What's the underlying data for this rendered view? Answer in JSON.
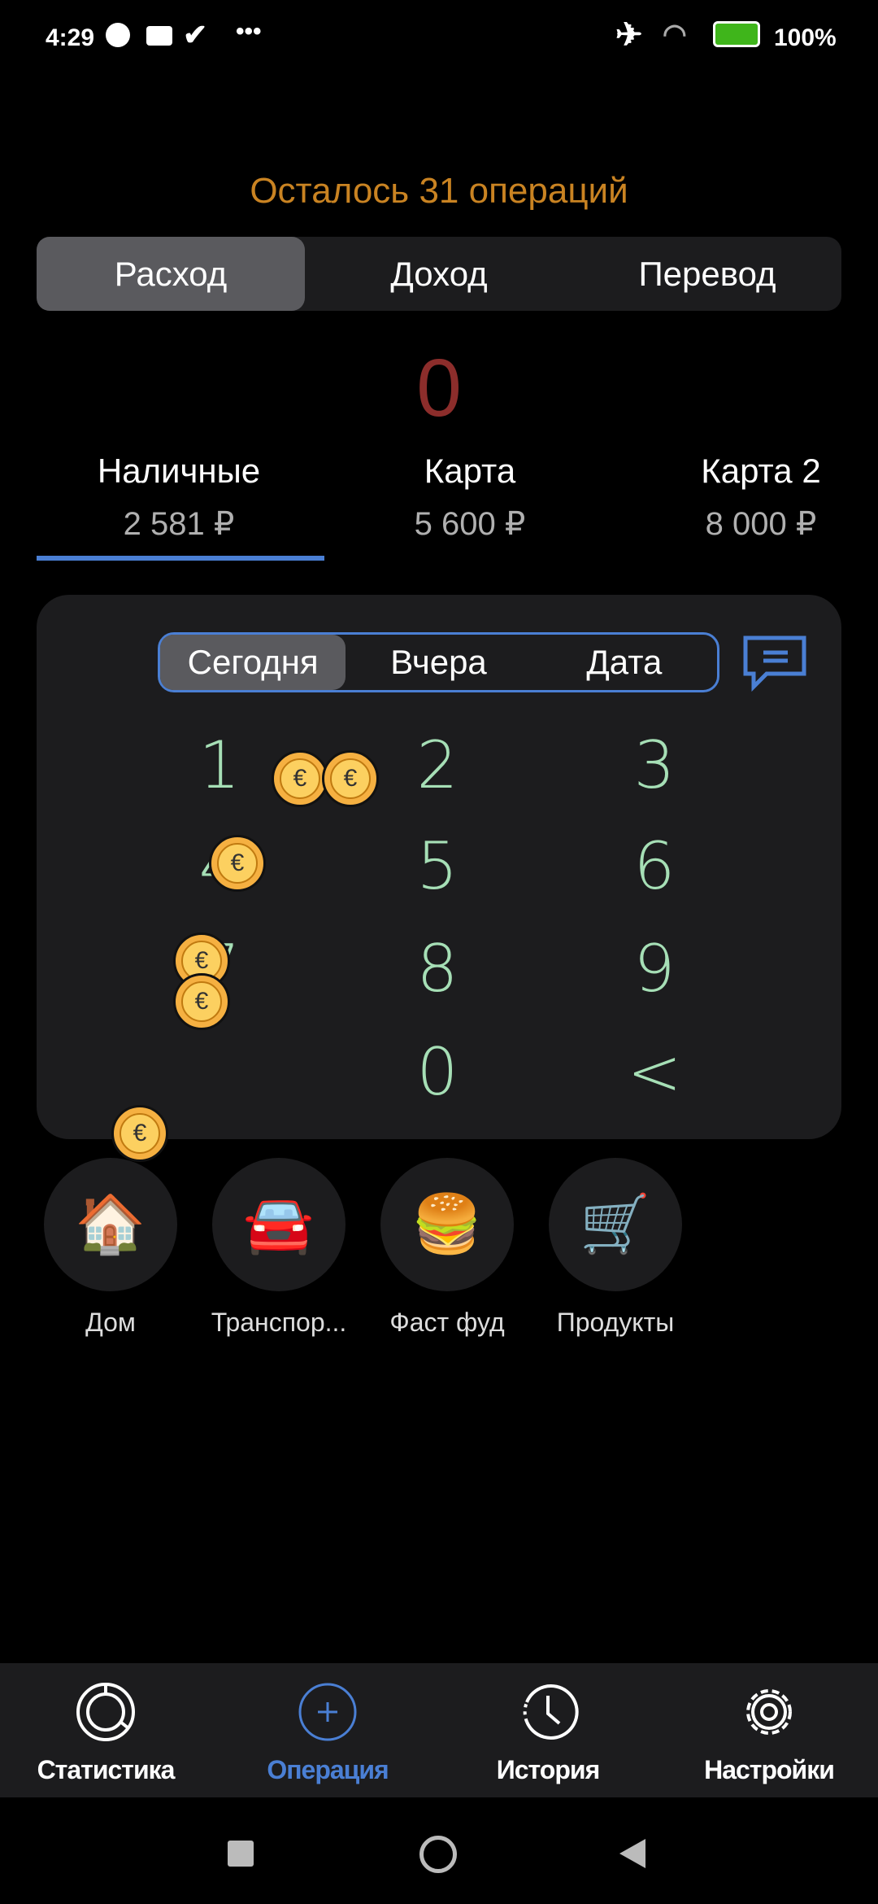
{
  "status_bar": {
    "time": "4:29",
    "battery": "100%",
    "icons": [
      "p-app-icon",
      "wallet-icon",
      "check-icon",
      "more-dots-icon",
      "airplane-icon",
      "wifi-icon",
      "battery-charging-icon"
    ]
  },
  "header": {
    "remaining": "Осталось 31 операций"
  },
  "type_tabs": [
    {
      "label": "Расход",
      "active": true
    },
    {
      "label": "Доход",
      "active": false
    },
    {
      "label": "Перевод",
      "active": false
    }
  ],
  "amount": "0",
  "accounts": [
    {
      "name": "Наличные",
      "balance": "2 581 ₽",
      "active": true
    },
    {
      "name": "Карта",
      "balance": "5 600 ₽"
    },
    {
      "name": "Карта 2",
      "balance": "8 000 ₽"
    }
  ],
  "date_tabs": [
    {
      "label": "Сегодня",
      "active": true
    },
    {
      "label": "Вчера"
    },
    {
      "label": "Дата"
    }
  ],
  "keypad": [
    "1",
    "2",
    "3",
    "4",
    "5",
    "6",
    "7",
    "8",
    "9",
    "0",
    "<"
  ],
  "categories": [
    {
      "label": "Дом",
      "icon": "🏠"
    },
    {
      "label": "Транспор...",
      "icon": "🚘"
    },
    {
      "label": "Фаст фуд",
      "icon": "🍔"
    },
    {
      "label": "Продукты",
      "icon": "🛒"
    }
  ],
  "coin_symbol": "€",
  "bottom_nav": [
    {
      "label": "Статистика"
    },
    {
      "label": "Операция",
      "active": true
    },
    {
      "label": "История"
    },
    {
      "label": "Настройки"
    }
  ],
  "colors": {
    "accent": "#4a7fd4",
    "remaining": "#c98322",
    "amount": "#8c2d2b",
    "keypad": "#a6dfb6"
  }
}
